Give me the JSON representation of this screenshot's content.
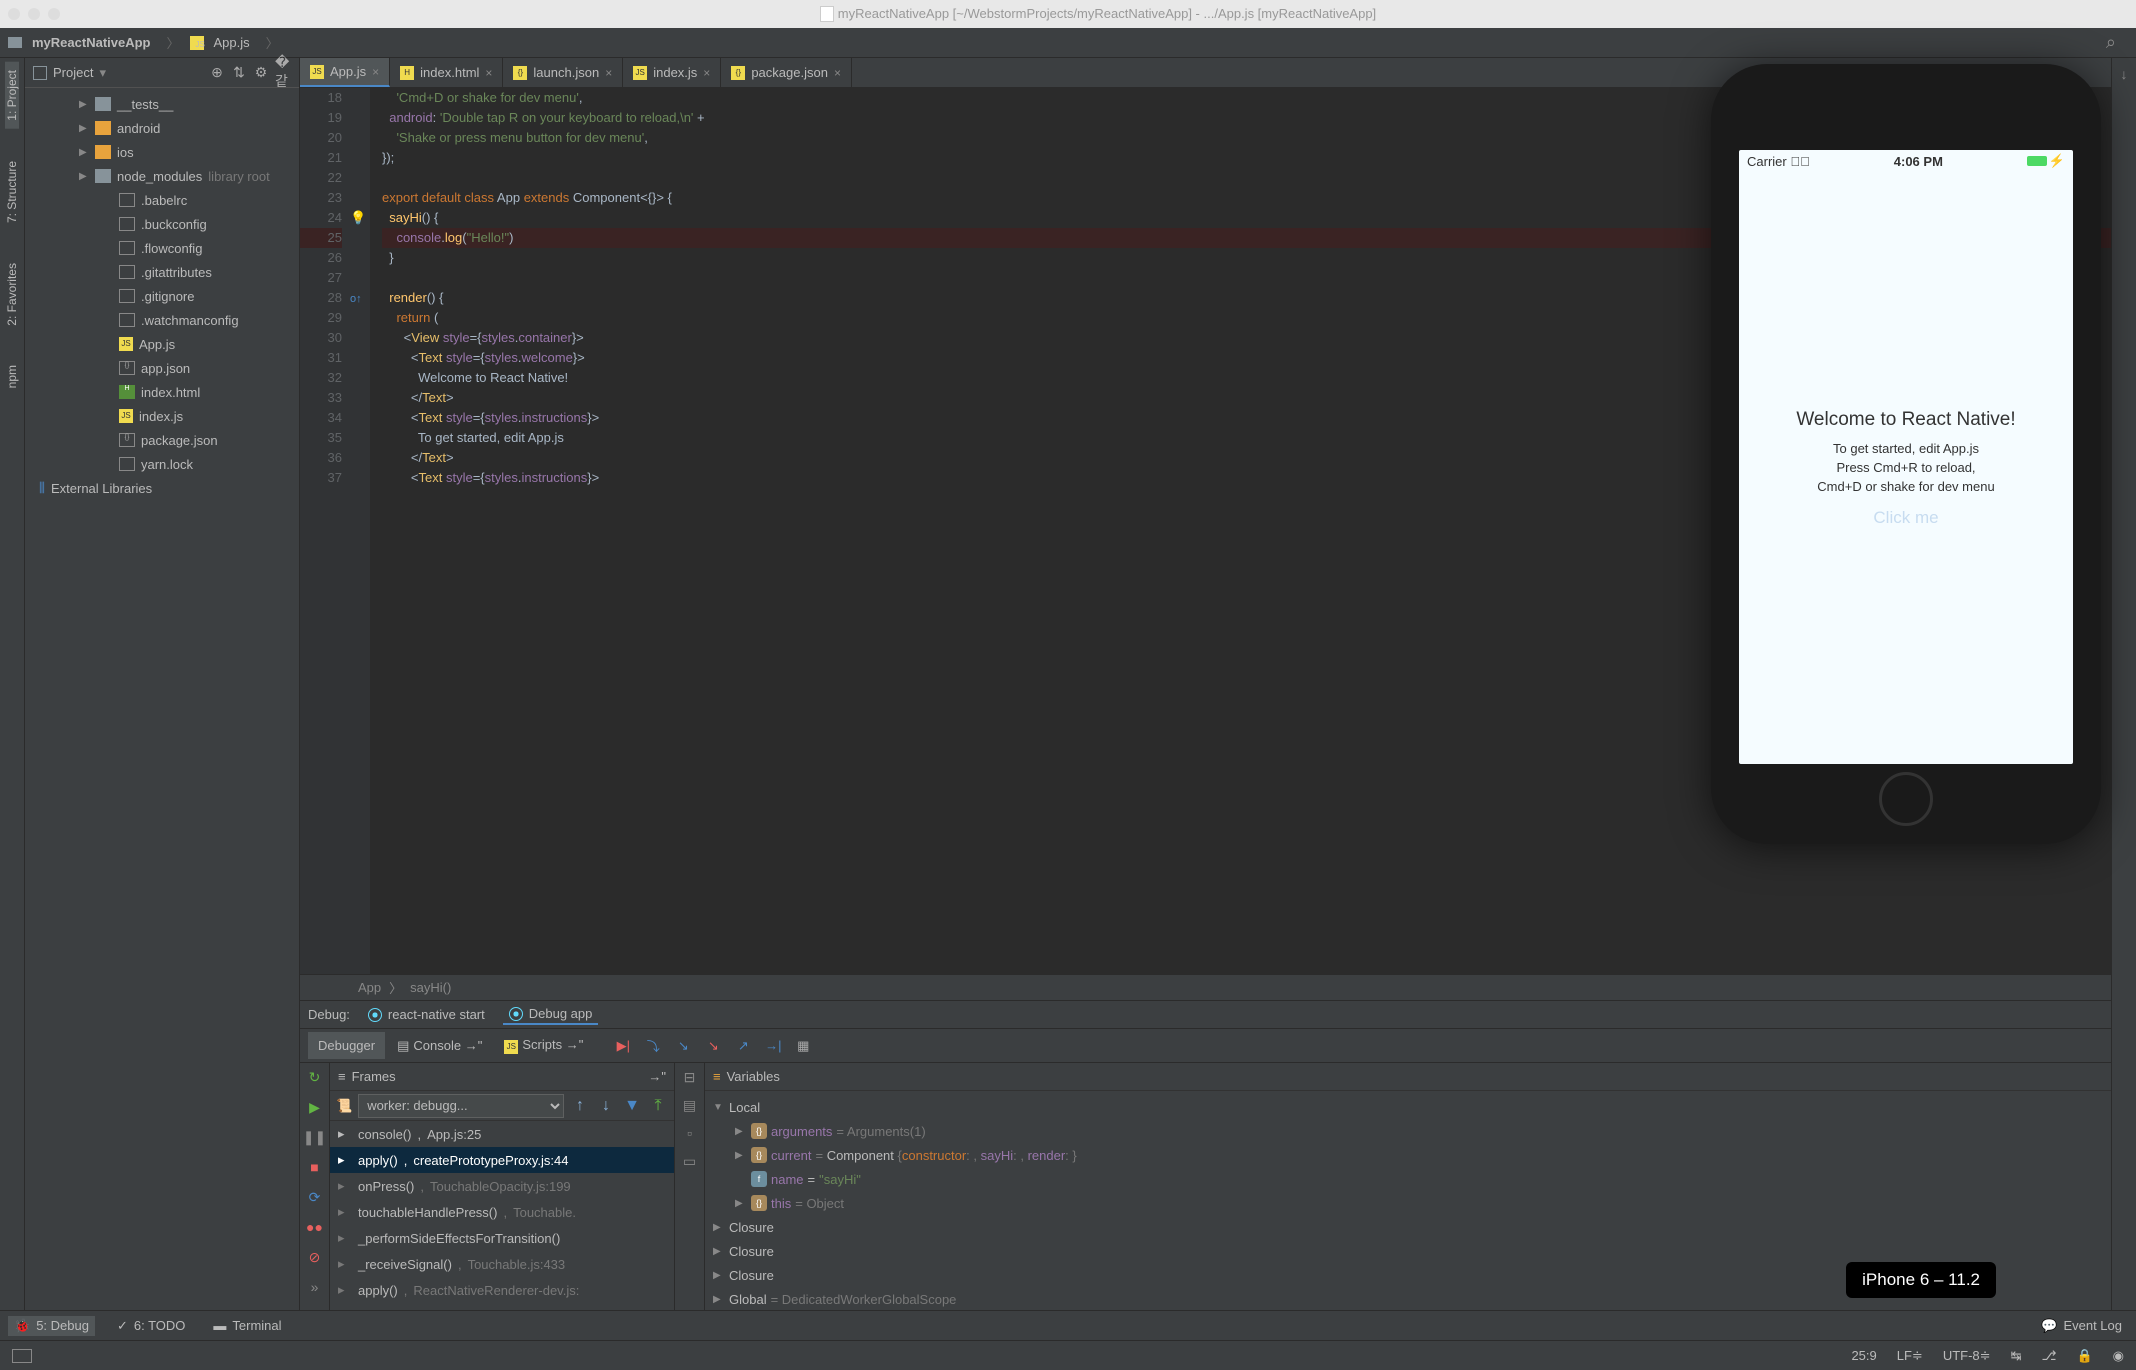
{
  "titlebar": "myReactNativeApp [~/WebstormProjects/myReactNativeApp] - .../App.js [myReactNativeApp]",
  "breadcrumb": {
    "project": "myReactNativeApp",
    "file": "App.js"
  },
  "leftStrip": {
    "project": "1: Project",
    "structure": "7: Structure",
    "favorites": "2: Favorites",
    "npm": "npm"
  },
  "projectPanel": {
    "title": "Project",
    "items": [
      {
        "label": "__tests__",
        "type": "folder-g",
        "arrow": "▶",
        "indent": 1
      },
      {
        "label": "android",
        "type": "folder-y",
        "arrow": "▶",
        "indent": 1
      },
      {
        "label": "ios",
        "type": "folder-y",
        "arrow": "▶",
        "indent": 1
      },
      {
        "label": "node_modules",
        "type": "folder-g",
        "arrow": "▶",
        "indent": 1,
        "suffix": "library root"
      },
      {
        "label": ".babelrc",
        "type": "file",
        "indent": 2
      },
      {
        "label": ".buckconfig",
        "type": "file",
        "indent": 2
      },
      {
        "label": ".flowconfig",
        "type": "file",
        "indent": 2
      },
      {
        "label": ".gitattributes",
        "type": "file",
        "indent": 2
      },
      {
        "label": ".gitignore",
        "type": "file",
        "indent": 2
      },
      {
        "label": ".watchmanconfig",
        "type": "file",
        "indent": 2
      },
      {
        "label": "App.js",
        "type": "js",
        "indent": 2
      },
      {
        "label": "app.json",
        "type": "json",
        "indent": 2
      },
      {
        "label": "index.html",
        "type": "html",
        "indent": 2
      },
      {
        "label": "index.js",
        "type": "js",
        "indent": 2
      },
      {
        "label": "package.json",
        "type": "json",
        "indent": 2
      },
      {
        "label": "yarn.lock",
        "type": "file",
        "indent": 2
      }
    ],
    "external": "External Libraries"
  },
  "tabs": [
    {
      "label": "App.js",
      "active": true,
      "icon": "js"
    },
    {
      "label": "index.html",
      "icon": "html"
    },
    {
      "label": "launch.json",
      "icon": "json"
    },
    {
      "label": "index.js",
      "icon": "js"
    },
    {
      "label": "package.json",
      "icon": "json"
    }
  ],
  "lineStart": 18,
  "lineEnd": 37,
  "breadcrumbBottom": {
    "a": "App",
    "b": "sayHi()"
  },
  "debug": {
    "label": "Debug:",
    "config1": "react-native start",
    "config2": "Debug app",
    "debugger": "Debugger",
    "console": "Console",
    "scripts": "Scripts",
    "framesTitle": "Frames",
    "worker": "worker: debugg...",
    "frames": [
      {
        "fn": "console()",
        "loc": "App.js:25",
        "hl": true
      },
      {
        "fn": "apply()",
        "loc": "createPrototypeProxy.js:44",
        "active": true
      },
      {
        "fn": "onPress()",
        "loc": "TouchableOpacity.js:199"
      },
      {
        "fn": "touchableHandlePress()",
        "loc": "Touchable."
      },
      {
        "fn": "_performSideEffectsForTransition()",
        "loc": ""
      },
      {
        "fn": "_receiveSignal()",
        "loc": "Touchable.js:433"
      },
      {
        "fn": "apply()",
        "loc": "ReactNativeRenderer-dev.js:"
      }
    ],
    "varsTitle": "Variables",
    "vars": {
      "local": "Local",
      "arguments": "arguments",
      "argumentsVal": " = Arguments(1)",
      "current": "current",
      "currentVal": " = Component {constructor: , sayHi: , render: }",
      "name": "name",
      "nameVal": " = \"sayHi\"",
      "this": "this",
      "thisVal": " = Object",
      "closure": "Closure",
      "global": "Global",
      "globalVal": " = DedicatedWorkerGlobalScope"
    }
  },
  "bottombar": {
    "debug": "5: Debug",
    "todo": "6: TODO",
    "terminal": "Terminal",
    "eventLog": "Event Log"
  },
  "statusbar": {
    "pos": "25:9",
    "lineend": "LF",
    "encoding": "UTF-8",
    "indent": "↹"
  },
  "phone": {
    "carrier": "Carrier",
    "time": "4:06 PM",
    "title": "Welcome to React Native!",
    "line1": "To get started, edit App.js",
    "line2": "Press Cmd+R to reload,",
    "line3": "Cmd+D or shake for dev menu",
    "button": "Click me",
    "label": "iPhone 6 – 11.2"
  }
}
